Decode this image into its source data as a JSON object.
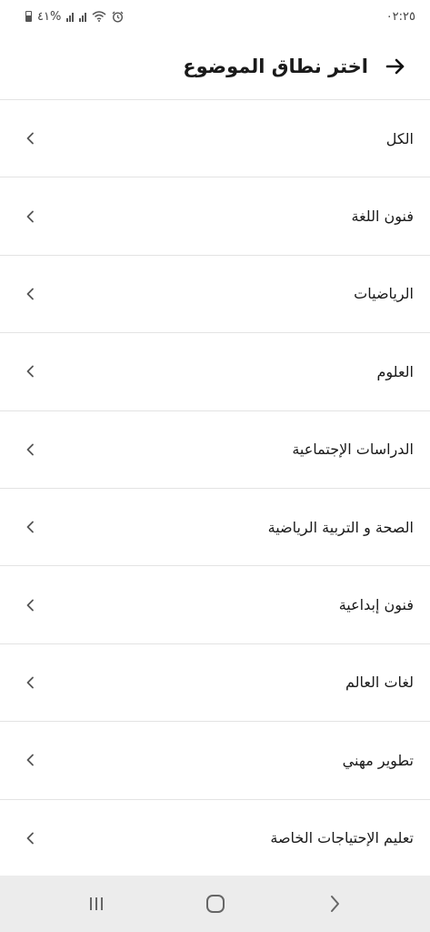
{
  "status_bar": {
    "battery_text": "%٤١",
    "time": "٠٢:٢٥"
  },
  "header": {
    "title": "اختر نطاق الموضوع",
    "back_icon": "arrow-right-icon"
  },
  "subjects": [
    {
      "label": "الكل"
    },
    {
      "label": "فنون اللغة"
    },
    {
      "label": "الرياضيات"
    },
    {
      "label": "العلوم"
    },
    {
      "label": "الدراسات الإجتماعية"
    },
    {
      "label": "الصحة و التربية الرياضية"
    },
    {
      "label": "فنون إبداعية"
    },
    {
      "label": "لغات العالم"
    },
    {
      "label": "تطوير مهني"
    },
    {
      "label": "تعليم الإحتياجات الخاصة"
    }
  ],
  "nav_bar": {
    "recents_icon": "recents-icon",
    "home_icon": "home-icon",
    "back_icon": "back-chevron-icon"
  },
  "colors": {
    "background": "#ffffff",
    "divider": "#e3e3e3",
    "text": "#1a1a1a",
    "nav_bar": "#ececec"
  }
}
